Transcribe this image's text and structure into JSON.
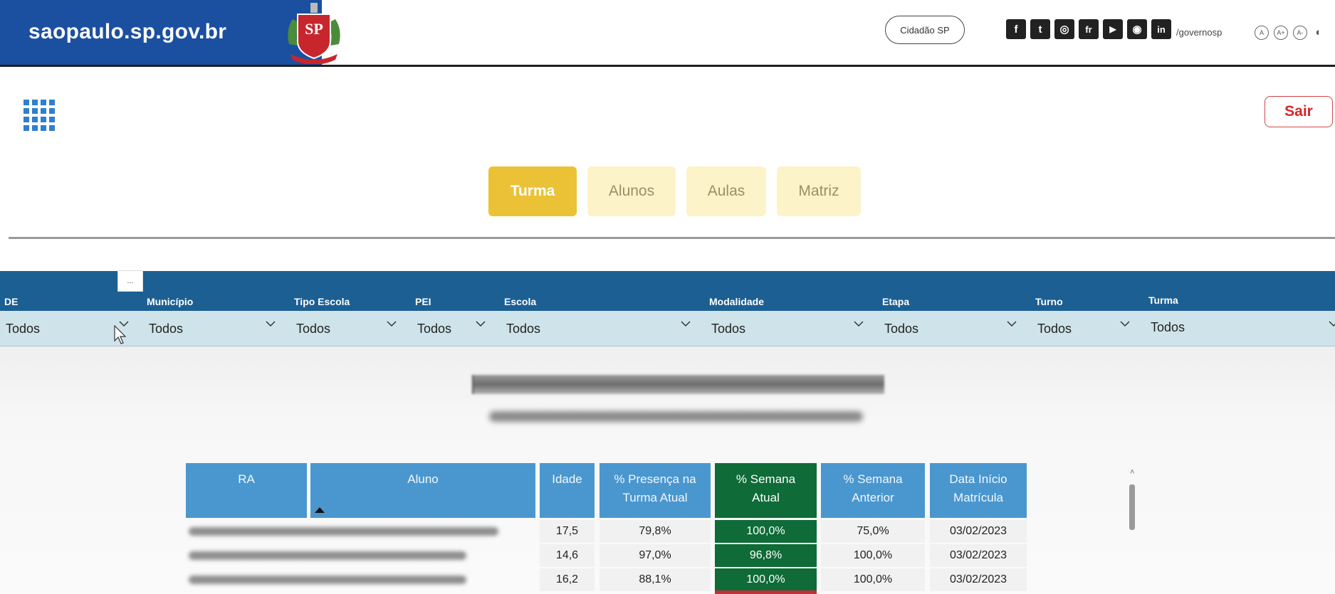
{
  "gov_header": {
    "domain": "saopaulo.sp.gov.br",
    "crest_text": "SP",
    "cidadao_label": "Cidadão SP",
    "social_icons": [
      {
        "name": "facebook-icon",
        "glyph": "f"
      },
      {
        "name": "twitter-icon",
        "glyph": "t"
      },
      {
        "name": "instagram-icon",
        "glyph": "◎"
      },
      {
        "name": "flickr-icon",
        "glyph": "fr"
      },
      {
        "name": "youtube-icon",
        "glyph": "▶"
      },
      {
        "name": "issuu-icon",
        "glyph": "◉"
      },
      {
        "name": "linkedin-icon",
        "glyph": "in"
      }
    ],
    "handle": "/governosp",
    "accessibility": [
      "A",
      "A+",
      "A-",
      "◐"
    ]
  },
  "toolbar": {
    "apps_icon": "apps-grid-icon",
    "sair_label": "Sair"
  },
  "tabs": [
    {
      "label": "Turma",
      "active": true
    },
    {
      "label": "Alunos",
      "active": false
    },
    {
      "label": "Aulas",
      "active": false
    },
    {
      "label": "Matriz",
      "active": false
    }
  ],
  "filters": [
    {
      "label": "DE",
      "value": "Todos"
    },
    {
      "label": "Município",
      "value": "Todos"
    },
    {
      "label": "Tipo Escola",
      "value": "Todos"
    },
    {
      "label": "PEI",
      "value": "Todos"
    },
    {
      "label": "Escola",
      "value": "Todos"
    },
    {
      "label": "Modalidade",
      "value": "Todos"
    },
    {
      "label": "Etapa",
      "value": "Todos"
    },
    {
      "label": "Turno",
      "value": "Todos"
    },
    {
      "label": "Turma",
      "value": "Todos"
    }
  ],
  "focus_chip": "...",
  "table": {
    "headers": [
      "RA",
      "Aluno",
      "Idade",
      "% Presença na Turma Atual",
      "% Semana Atual",
      "% Semana Anterior",
      "Data Início Matrícula"
    ],
    "rows": [
      {
        "idade": "17,5",
        "presenca": "79,8%",
        "semana_atual": "100,0%",
        "semana_anterior": "75,0%",
        "data": "03/02/2023"
      },
      {
        "idade": "14,6",
        "presenca": "97,0%",
        "semana_atual": "96,8%",
        "semana_anterior": "100,0%",
        "data": "03/02/2023"
      },
      {
        "idade": "16,2",
        "presenca": "88,1%",
        "semana_atual": "100,0%",
        "semana_anterior": "100,0%",
        "data": "03/02/2023"
      }
    ]
  },
  "colors": {
    "gov_blue": "#1b4fa0",
    "filter_header": "#1c5f93",
    "filter_row": "#cfe4ea",
    "tab_active": "#ebc235",
    "tab_inactive": "#fdf3c8",
    "table_header": "#4a97cf",
    "highlight_green": "#0f6b37",
    "sair_red": "#d62626"
  }
}
